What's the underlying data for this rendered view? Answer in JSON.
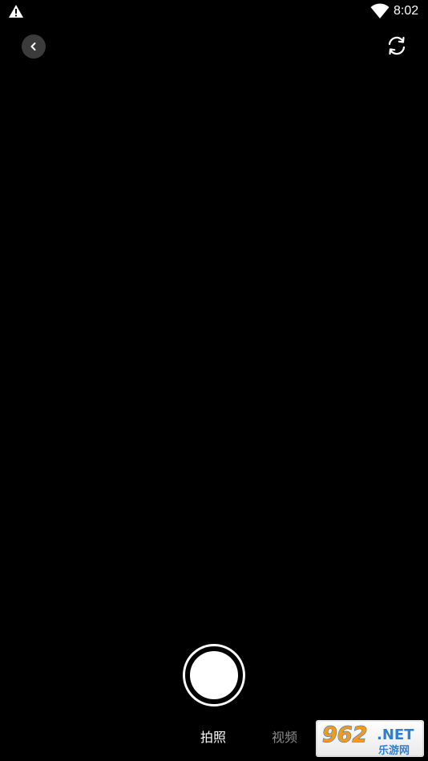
{
  "status_bar": {
    "time": "8:02",
    "icons": [
      "warning-icon",
      "wifi-icon"
    ]
  },
  "top_bar": {
    "back_icon": "chevron-left-icon",
    "switch_camera_icon": "camera-switch-icon"
  },
  "modes": [
    {
      "label": "拍照",
      "selected": true
    },
    {
      "label": "视频",
      "selected": false
    }
  ],
  "watermark": {
    "brand": "962",
    "suffix": ".NET",
    "subtitle": "乐游网"
  },
  "colors": {
    "background": "#000000",
    "active_tab": "#ffffff",
    "inactive_tab": "#8c8c8c",
    "watermark_orange": "#f39a1e",
    "watermark_blue": "#2b7fd4"
  }
}
